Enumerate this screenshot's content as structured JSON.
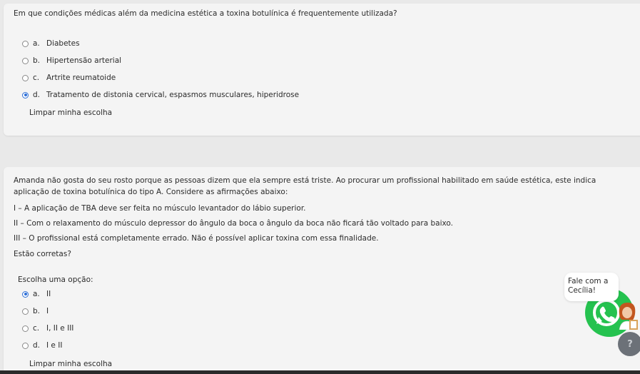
{
  "question1": {
    "text": "Em que condições médicas além da medicina estética a toxina botulínica é frequentemente utilizada?",
    "options": [
      {
        "letter": "a.",
        "label": "Diabetes",
        "selected": false
      },
      {
        "letter": "b.",
        "label": "Hipertensão arterial",
        "selected": false
      },
      {
        "letter": "c.",
        "label": "Artrite reumatoide",
        "selected": false
      },
      {
        "letter": "d.",
        "label": "Tratamento de distonia cervical, espasmos musculares, hiperidrose",
        "selected": true
      }
    ],
    "clear_label": "Limpar minha escolha"
  },
  "question2": {
    "text_line1": "Amanda não gosta do seu rosto porque as pessoas dizem que ela sempre está triste. Ao procurar um profissional habilitado em saúde estética, este indica",
    "text_line2": "aplicação de toxina botulínica do tipo A. Considere as afirmações abaixo:",
    "statement1": "I – A aplicação de TBA deve ser feita no músculo levantador do lábio superior.",
    "statement2": "II – Com o relaxamento do músculo depressor do ângulo da boca o ângulo da boca não ficará tão voltado para baixo.",
    "statement3": "III – O profissional está completamente errado. Não é possível aplicar toxina com essa finalidade.",
    "question": "Estão corretas?",
    "prompt": "Escolha uma opção:",
    "options": [
      {
        "letter": "a.",
        "label": "II",
        "selected": true
      },
      {
        "letter": "b.",
        "label": "I",
        "selected": false
      },
      {
        "letter": "c.",
        "label": "I, II e III",
        "selected": false
      },
      {
        "letter": "d.",
        "label": "I e II",
        "selected": false
      }
    ],
    "clear_label": "Limpar minha escolha"
  },
  "chat_widget": {
    "line1": "Fale com a",
    "line2": "Cecília!",
    "icon": "whatsapp-icon"
  },
  "help_button": {
    "label": "?"
  },
  "colors": {
    "background": "#e9e9e9",
    "card": "#f4f4f4",
    "radio_selected": "#2f6fd6",
    "whatsapp_green": "#25c24f",
    "help_gray": "#6c7178"
  }
}
